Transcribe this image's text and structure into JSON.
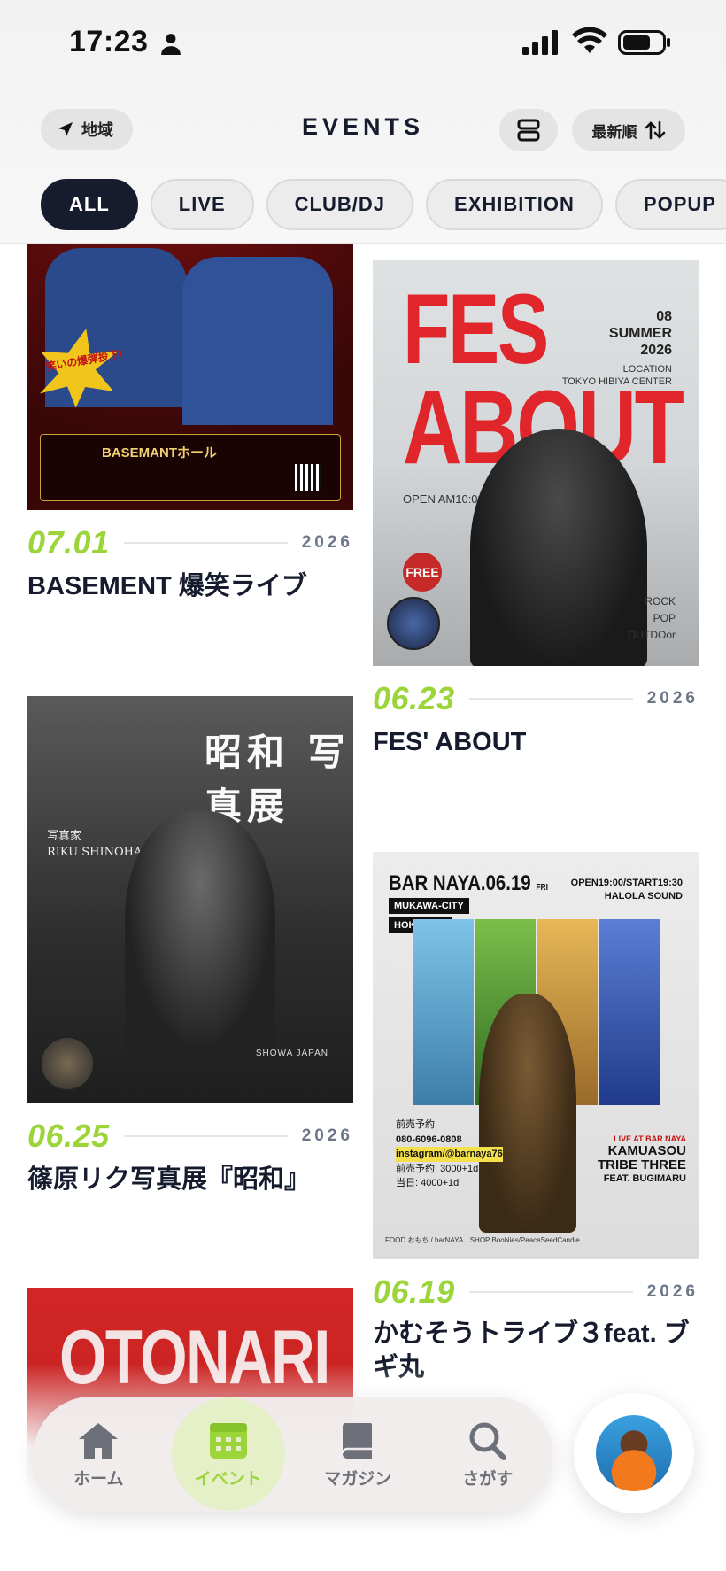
{
  "status_bar": {
    "time": "17:23"
  },
  "header": {
    "region_label": "地域",
    "title": "EVENTS",
    "sort_label": "最新順"
  },
  "filters": [
    "ALL",
    "LIVE",
    "CLUB/DJ",
    "EXHIBITION",
    "POPUP"
  ],
  "active_filter": "ALL",
  "events": [
    {
      "date": "07.01",
      "year": "2026",
      "title": "BASEMENT 爆笑ライブ",
      "poster": {
        "burst": "笑いの爆弾投下!",
        "venue": "BASEMANTホール"
      }
    },
    {
      "date": "06.23",
      "year": "2026",
      "title": "FES' ABOUT",
      "poster": {
        "line1": "FES",
        "line2": "ABOUT",
        "meta_date": "08",
        "meta_season": "SUMMER",
        "meta_year": "2026",
        "location_label": "LOCATION",
        "location": "TOKYO HIBIYA CENTER",
        "open": "OPEN AM10:00",
        "free": "FREE",
        "genre1": "ROCK",
        "genre2": "POP",
        "genre3": "OUTDOor"
      }
    },
    {
      "date": "06.25",
      "year": "2026",
      "title": "篠原リク写真展『昭和』",
      "poster": {
        "title": "昭和 写真展",
        "photographer_ja": "写真家",
        "photographer_en": "RIKU SHINOHARA",
        "subtitle_en": "SHOWA JAPAN"
      }
    },
    {
      "date": "06.19",
      "year": "2026",
      "title": "かむそうトライブ３feat. ブギ丸",
      "poster": {
        "heading": "BAR NAYA.06.19",
        "heading_day": "FRI",
        "open": "OPEN19:00/START19:30",
        "sound": "HALOLA SOUND",
        "tag1": "MUKAWA-CITY",
        "tag2": "HOKKAIDO",
        "booking_label": "前売予約",
        "phone": "080-6096-0808",
        "instagram": "instagram/@barnaya76",
        "price1": "前売予約: 3000+1d",
        "price2": "当日: 4000+1d",
        "live_at": "LIVE AT BAR NAYA",
        "act_line1": "KAMUASOU",
        "act_line2": "TRIBE THREE",
        "act_line3": "FEAT. BUGIMARU",
        "footer": "FOOD おもち / barNAYA　SHOP BooNies/PeaceSeedCandle"
      }
    },
    {
      "poster": {
        "title": "OTONARI"
      }
    }
  ],
  "tabbar": {
    "items": [
      {
        "label": "ホーム",
        "icon": "home-icon"
      },
      {
        "label": "イベント",
        "icon": "calendar-icon"
      },
      {
        "label": "マガジン",
        "icon": "book-icon"
      },
      {
        "label": "さがす",
        "icon": "search-icon"
      }
    ],
    "active": "イベント"
  },
  "colors": {
    "accent_green": "#9bd53a",
    "navy": "#161c2e",
    "poster_red": "#e0262b"
  }
}
